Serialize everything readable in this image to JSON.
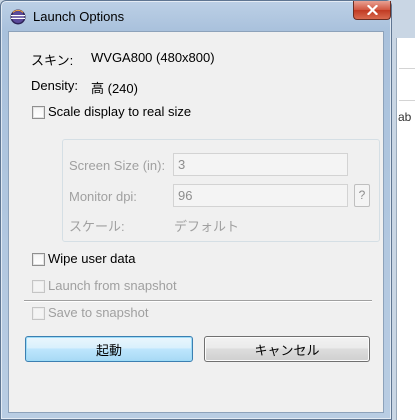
{
  "window": {
    "title": "Launch Options"
  },
  "info": {
    "skin_label": "スキン:",
    "skin_value": "WVGA800 (480x800)",
    "density_label": "Density:",
    "density_value": "高 (240)"
  },
  "options": {
    "scale_display": {
      "label": "Scale display to real size",
      "checked": false,
      "enabled": true
    },
    "wipe_user_data": {
      "label": "Wipe user data",
      "checked": false,
      "enabled": true
    },
    "launch_from_snapshot": {
      "label": "Launch from snapshot",
      "checked": false,
      "enabled": false
    },
    "save_to_snapshot": {
      "label": "Save to snapshot",
      "checked": false,
      "enabled": false
    }
  },
  "scale_group": {
    "screen_size_label": "Screen Size (in):",
    "screen_size_value": "3",
    "monitor_dpi_label": "Monitor dpi:",
    "monitor_dpi_value": "96",
    "help_label": "?",
    "scale_label": "スケール:",
    "scale_value": "デフォルト"
  },
  "buttons": {
    "launch": "起動",
    "cancel": "キャンセル"
  },
  "background": {
    "partial_text": "ab"
  },
  "colors": {
    "title_bar": "#a9c1dc",
    "close_button": "#c13a22",
    "default_button_border": "#3c7fb1",
    "disabled_text": "#a0a0a0"
  },
  "icons": {
    "app": "eclipse-icon",
    "close": "close-icon"
  }
}
